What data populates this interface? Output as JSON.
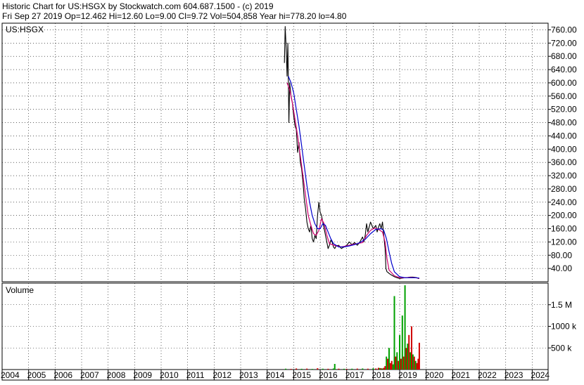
{
  "header": {
    "line1": "Historic Chart for US:HSGX by Stockwatch.com 604.687.1500 - (c) 2019",
    "line2": "Fri Sep 27 2019   Op=12.462   Hi=12.60   Lo=9.00   Cl=9.72   Vol=504,858   Year hi=778.20   lo=4.80"
  },
  "chart_data": [
    {
      "type": "line",
      "panel": "price",
      "title": "US:HSGX",
      "xlabel": "",
      "ylabel": "",
      "x_unit": "year (fractional)",
      "xlim": [
        2004.0,
        2024.6
      ],
      "ylim": [
        0,
        780
      ],
      "y_ticks": [
        40,
        80,
        120,
        160,
        200,
        240,
        280,
        320,
        360,
        400,
        440,
        480,
        520,
        560,
        600,
        640,
        680,
        720,
        760
      ],
      "y_tick_labels": [
        "40.00",
        "80.00",
        "120.00",
        "160.00",
        "200.00",
        "240.00",
        "280.00",
        "320.00",
        "360.00",
        "400.00",
        "440.00",
        "480.00",
        "520.00",
        "560.00",
        "600.00",
        "640.00",
        "680.00",
        "720.00",
        "760.00"
      ],
      "x_tick_labels": [
        "2004",
        "2005",
        "2006",
        "2007",
        "2008",
        "2009",
        "2010",
        "2011",
        "2012",
        "2013",
        "2014",
        "2015",
        "2016",
        "2017",
        "2018",
        "2019",
        "2020",
        "2021",
        "2022",
        "2023",
        "2024"
      ],
      "grid": true,
      "series": [
        {
          "role": "price",
          "color": "#000000",
          "x": [
            2014.65,
            2014.68,
            2014.72,
            2014.75,
            2014.78,
            2014.82,
            2014.85,
            2014.9,
            2014.95,
            2015.0,
            2015.05,
            2015.1,
            2015.15,
            2015.2,
            2015.25,
            2015.3,
            2015.35,
            2015.4,
            2015.45,
            2015.5,
            2015.55,
            2015.6,
            2015.65,
            2015.7,
            2015.75,
            2015.8,
            2015.85,
            2015.9,
            2015.95,
            2016.0,
            2016.05,
            2016.1,
            2016.15,
            2016.2,
            2016.25,
            2016.3,
            2016.35,
            2016.4,
            2016.45,
            2016.5,
            2016.55,
            2016.6,
            2016.7,
            2016.8,
            2016.9,
            2017.0,
            2017.1,
            2017.2,
            2017.3,
            2017.4,
            2017.5,
            2017.6,
            2017.65,
            2017.7,
            2017.75,
            2017.8,
            2017.85,
            2017.9,
            2018.0,
            2018.1,
            2018.15,
            2018.2,
            2018.25,
            2018.3,
            2018.35,
            2018.4,
            2018.45,
            2018.48,
            2018.52,
            2018.56,
            2018.6,
            2018.65,
            2018.7,
            2018.8,
            2018.9,
            2019.0,
            2019.1,
            2019.2,
            2019.3,
            2019.4,
            2019.5,
            2019.6,
            2019.65,
            2019.7,
            2019.74
          ],
          "y": [
            660,
            770,
            700,
            620,
            720,
            480,
            600,
            560,
            540,
            500,
            470,
            460,
            390,
            420,
            360,
            340,
            300,
            250,
            220,
            180,
            160,
            150,
            170,
            130,
            120,
            140,
            130,
            200,
            240,
            210,
            200,
            180,
            160,
            140,
            120,
            100,
            110,
            125,
            120,
            105,
            100,
            108,
            110,
            100,
            105,
            110,
            120,
            112,
            118,
            110,
            120,
            135,
            120,
            140,
            175,
            150,
            165,
            180,
            160,
            170,
            150,
            165,
            175,
            160,
            180,
            140,
            100,
            40,
            30,
            28,
            25,
            22,
            20,
            15,
            12,
            10,
            11,
            12,
            13,
            14,
            14,
            13,
            12,
            10,
            9.72
          ]
        },
        {
          "role": "moving-average-short",
          "color": "#d0006f",
          "x": [
            2014.75,
            2014.85,
            2014.95,
            2015.05,
            2015.15,
            2015.25,
            2015.35,
            2015.45,
            2015.55,
            2015.65,
            2015.75,
            2015.85,
            2015.95,
            2016.05,
            2016.15,
            2016.25,
            2016.35,
            2016.45,
            2016.6,
            2016.8,
            2017.0,
            2017.2,
            2017.4,
            2017.6,
            2017.75,
            2017.9,
            2018.05,
            2018.2,
            2018.35,
            2018.45,
            2018.52,
            2018.6,
            2018.8,
            2019.0,
            2019.2,
            2019.4,
            2019.6,
            2019.74
          ],
          "y": [
            600,
            580,
            540,
            490,
            440,
            380,
            320,
            260,
            200,
            170,
            145,
            140,
            155,
            190,
            175,
            140,
            115,
            112,
            108,
            105,
            108,
            112,
            115,
            118,
            140,
            155,
            162,
            158,
            150,
            120,
            70,
            35,
            18,
            12,
            12,
            13,
            12,
            10
          ]
        },
        {
          "role": "moving-average-long",
          "color": "#0000cc",
          "x": [
            2014.8,
            2014.9,
            2015.0,
            2015.1,
            2015.2,
            2015.3,
            2015.4,
            2015.5,
            2015.6,
            2015.7,
            2015.8,
            2015.9,
            2016.0,
            2016.1,
            2016.2,
            2016.3,
            2016.4,
            2016.5,
            2016.7,
            2016.9,
            2017.1,
            2017.3,
            2017.5,
            2017.7,
            2017.9,
            2018.1,
            2018.3,
            2018.4,
            2018.5,
            2018.6,
            2018.7,
            2018.8,
            2019.0,
            2019.2,
            2019.4,
            2019.6,
            2019.74
          ],
          "y": [
            620,
            600,
            570,
            520,
            470,
            410,
            350,
            290,
            240,
            200,
            175,
            160,
            160,
            175,
            170,
            150,
            130,
            115,
            105,
            105,
            108,
            112,
            118,
            128,
            145,
            158,
            160,
            155,
            130,
            90,
            55,
            30,
            15,
            12,
            12,
            12,
            11
          ]
        }
      ]
    },
    {
      "type": "bar",
      "panel": "volume",
      "title": "Volume",
      "xlabel": "",
      "ylabel": "",
      "x_unit": "year (fractional)",
      "xlim": [
        2004.0,
        2024.6
      ],
      "ylim": [
        0,
        2000000
      ],
      "y_ticks": [
        500000,
        1000000,
        1500000
      ],
      "y_tick_labels": [
        "500 k",
        "1000 k",
        "1.5 M"
      ],
      "grid": true,
      "colors": {
        "up": "#00a000",
        "down": "#d00000"
      },
      "bars": {
        "x": [
          2014.7,
          2014.9,
          2015.1,
          2015.3,
          2015.5,
          2015.7,
          2015.9,
          2016.1,
          2016.3,
          2016.5,
          2016.7,
          2016.9,
          2017.0,
          2017.2,
          2017.4,
          2017.6,
          2017.8,
          2018.0,
          2018.1,
          2018.2,
          2018.25,
          2018.3,
          2018.35,
          2018.4,
          2018.45,
          2018.5,
          2018.55,
          2018.6,
          2018.65,
          2018.7,
          2018.75,
          2018.8,
          2018.85,
          2018.9,
          2018.95,
          2019.0,
          2019.05,
          2019.1,
          2019.15,
          2019.2,
          2019.25,
          2019.3,
          2019.35,
          2019.4,
          2019.45,
          2019.5,
          2019.55,
          2019.6,
          2019.65,
          2019.7,
          2019.74
        ],
        "values": [
          20000,
          15000,
          25000,
          18000,
          22000,
          15000,
          30000,
          20000,
          18000,
          25000,
          20000,
          18000,
          15000,
          20000,
          22000,
          25000,
          20000,
          30000,
          25000,
          40000,
          35000,
          30000,
          25000,
          40000,
          80000,
          300000,
          250000,
          500000,
          150000,
          200000,
          120000,
          1700000,
          300000,
          400000,
          200000,
          800000,
          250000,
          1250000,
          300000,
          1950000,
          500000,
          600000,
          800000,
          400000,
          1000000,
          350000,
          300000,
          200000,
          150000,
          250000,
          620000
        ],
        "direction": [
          "up",
          "down",
          "down",
          "up",
          "down",
          "up",
          "down",
          "up",
          "down",
          "up",
          "down",
          "up",
          "down",
          "up",
          "down",
          "up",
          "down",
          "up",
          "down",
          "down",
          "up",
          "down",
          "up",
          "down",
          "down",
          "up",
          "down",
          "up",
          "down",
          "down",
          "up",
          "up",
          "down",
          "up",
          "down",
          "up",
          "down",
          "up",
          "down",
          "up",
          "down",
          "up",
          "down",
          "up",
          "down",
          "up",
          "down",
          "up",
          "down",
          "down",
          "down"
        ]
      },
      "highlight": {
        "x": 2016.55,
        "value": 130000,
        "color": "#00a000"
      }
    }
  ]
}
